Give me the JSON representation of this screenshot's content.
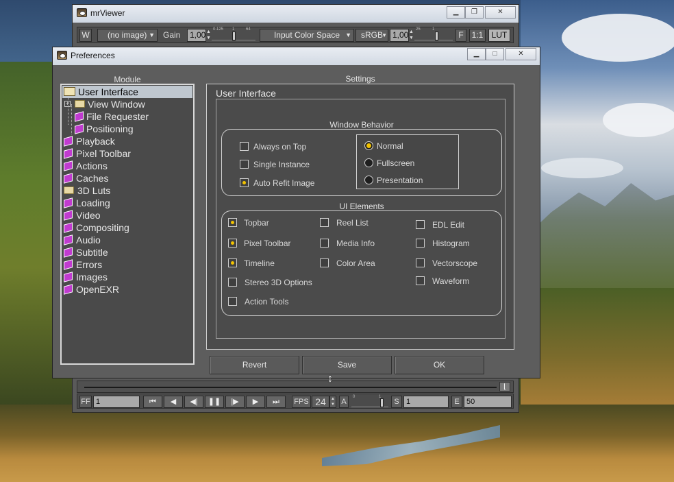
{
  "viewer": {
    "title": "mrViewer",
    "toolbar": {
      "w_button": "W",
      "image_select": "(no image)",
      "gain_label": "Gain",
      "gain_value": "1,00",
      "gain_ticks": [
        "0.125",
        "1",
        "64"
      ],
      "input_color_space": "Input Color Space",
      "output_space": "sRGB",
      "gamma_value": "1,00",
      "gamma_ticks": [
        "25",
        "1"
      ],
      "f_button": "F",
      "ratio_button": "1:1",
      "lut_button": "LUT"
    },
    "bottombar": {
      "ff_label": "FF",
      "frame_value": "1",
      "fps_label": "FPS",
      "fps_value": "24",
      "a_label": "A",
      "a_ticks": [
        "0",
        "1"
      ],
      "s_label": "S",
      "start_value": "1",
      "e_label": "E",
      "end_value": "50"
    }
  },
  "prefs": {
    "title": "Preferences",
    "module_header": "Module",
    "settings_header": "Settings",
    "tree": [
      {
        "label": "User Interface",
        "icon": "open-folder-icon",
        "selected": true
      },
      {
        "label": "View Window",
        "icon": "folder-icon"
      },
      {
        "label": "File Requester",
        "icon": "book-icon"
      },
      {
        "label": "Positioning",
        "icon": "book-icon"
      },
      {
        "label": "Playback",
        "icon": "book-icon"
      },
      {
        "label": "Pixel Toolbar",
        "icon": "book-icon"
      },
      {
        "label": "Actions",
        "icon": "book-icon"
      },
      {
        "label": "Caches",
        "icon": "book-icon"
      },
      {
        "label": "3D Luts",
        "icon": "folder-icon"
      },
      {
        "label": "Loading",
        "icon": "book-icon"
      },
      {
        "label": "Video",
        "icon": "book-icon"
      },
      {
        "label": "Compositing",
        "icon": "book-icon"
      },
      {
        "label": "Audio",
        "icon": "book-icon"
      },
      {
        "label": "Subtitle",
        "icon": "book-icon"
      },
      {
        "label": "Errors",
        "icon": "book-icon"
      },
      {
        "label": "Images",
        "icon": "book-icon"
      },
      {
        "label": "OpenEXR",
        "icon": "book-icon"
      }
    ],
    "panel_title": "User Interface",
    "window_behavior": {
      "title": "Window Behavior",
      "checks": [
        {
          "label": "Always on Top",
          "checked": false
        },
        {
          "label": "Single Instance",
          "checked": false
        },
        {
          "label": "Auto Refit Image",
          "checked": true
        }
      ],
      "radios": [
        {
          "label": "Normal",
          "selected": true
        },
        {
          "label": "Fullscreen",
          "selected": false
        },
        {
          "label": "Presentation",
          "selected": false
        }
      ]
    },
    "ui_elements": {
      "title": "UI Elements",
      "col1": [
        {
          "label": "Topbar",
          "checked": true
        },
        {
          "label": "Pixel Toolbar",
          "checked": true
        },
        {
          "label": "Timeline",
          "checked": true
        },
        {
          "label": "Stereo 3D Options",
          "checked": false
        },
        {
          "label": "Action Tools",
          "checked": false
        }
      ],
      "col2": [
        {
          "label": "Reel List",
          "checked": false
        },
        {
          "label": "Media Info",
          "checked": false
        },
        {
          "label": "Color Area",
          "checked": false
        }
      ],
      "col3": [
        {
          "label": "EDL Edit",
          "checked": false
        },
        {
          "label": "Histogram",
          "checked": false
        },
        {
          "label": "Vectorscope",
          "checked": false
        },
        {
          "label": "Waveform",
          "checked": false
        }
      ]
    },
    "buttons": {
      "revert": "Revert",
      "save": "Save",
      "ok": "OK"
    }
  },
  "colors": {
    "accent": "#f2c200",
    "book": "#c13bd0",
    "panel": "#4b4b4b"
  }
}
